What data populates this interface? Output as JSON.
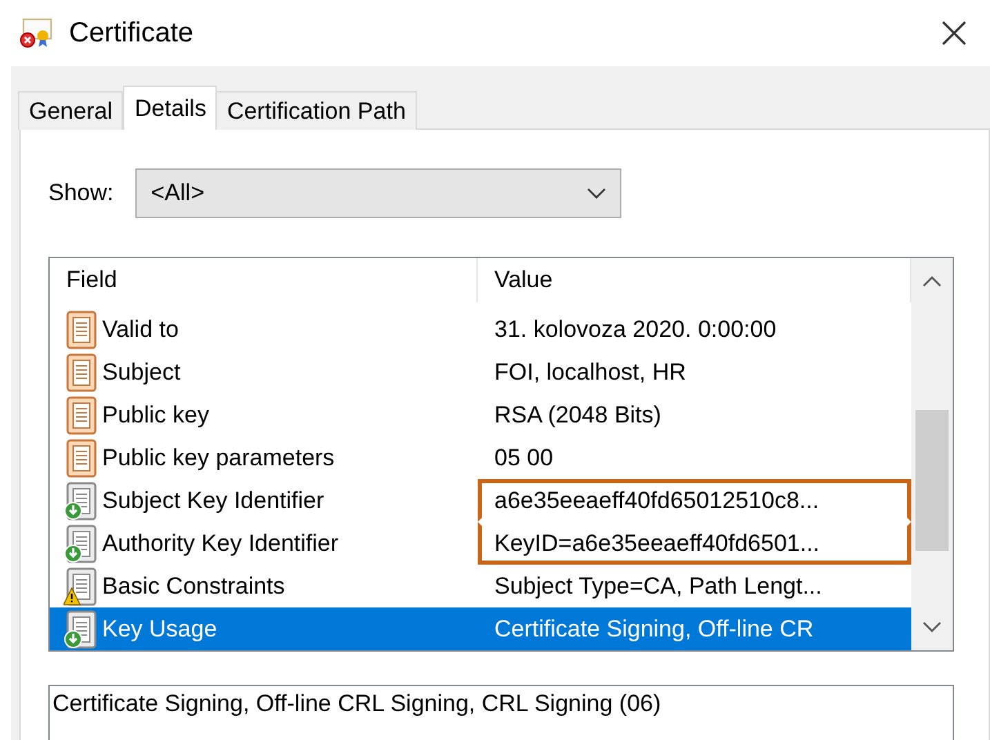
{
  "window": {
    "title": "Certificate"
  },
  "tabs": [
    {
      "label": "General",
      "selected": false
    },
    {
      "label": "Details",
      "selected": true
    },
    {
      "label": "Certification Path",
      "selected": false
    }
  ],
  "show": {
    "label": "Show:",
    "value": "<All>"
  },
  "table": {
    "columns": [
      "Field",
      "Value"
    ],
    "rows": [
      {
        "kind": "field",
        "field": "Valid to",
        "value": "31. kolovoza 2020. 0:00:00",
        "selected": false,
        "highlighted": false
      },
      {
        "kind": "field",
        "field": "Subject",
        "value": "FOI, localhost, HR",
        "selected": false,
        "highlighted": false
      },
      {
        "kind": "field",
        "field": "Public key",
        "value": "RSA (2048 Bits)",
        "selected": false,
        "highlighted": false
      },
      {
        "kind": "field",
        "field": "Public key parameters",
        "value": "05 00",
        "selected": false,
        "highlighted": false
      },
      {
        "kind": "extension",
        "field": "Subject Key Identifier",
        "value": "a6e35eeaeff40fd65012510c8...",
        "selected": false,
        "highlighted": true
      },
      {
        "kind": "extension",
        "field": "Authority Key Identifier",
        "value": "KeyID=a6e35eeaeff40fd6501...",
        "selected": false,
        "highlighted": true
      },
      {
        "kind": "critical",
        "field": "Basic Constraints",
        "value": "Subject Type=CA, Path Lengt...",
        "selected": false,
        "highlighted": false
      },
      {
        "kind": "extension",
        "field": "Key Usage",
        "value": "Certificate Signing, Off-line CR",
        "selected": true,
        "highlighted": false
      }
    ]
  },
  "detail": {
    "value": "Certificate Signing, Off-line CRL Signing, CRL Signing (06)"
  }
}
